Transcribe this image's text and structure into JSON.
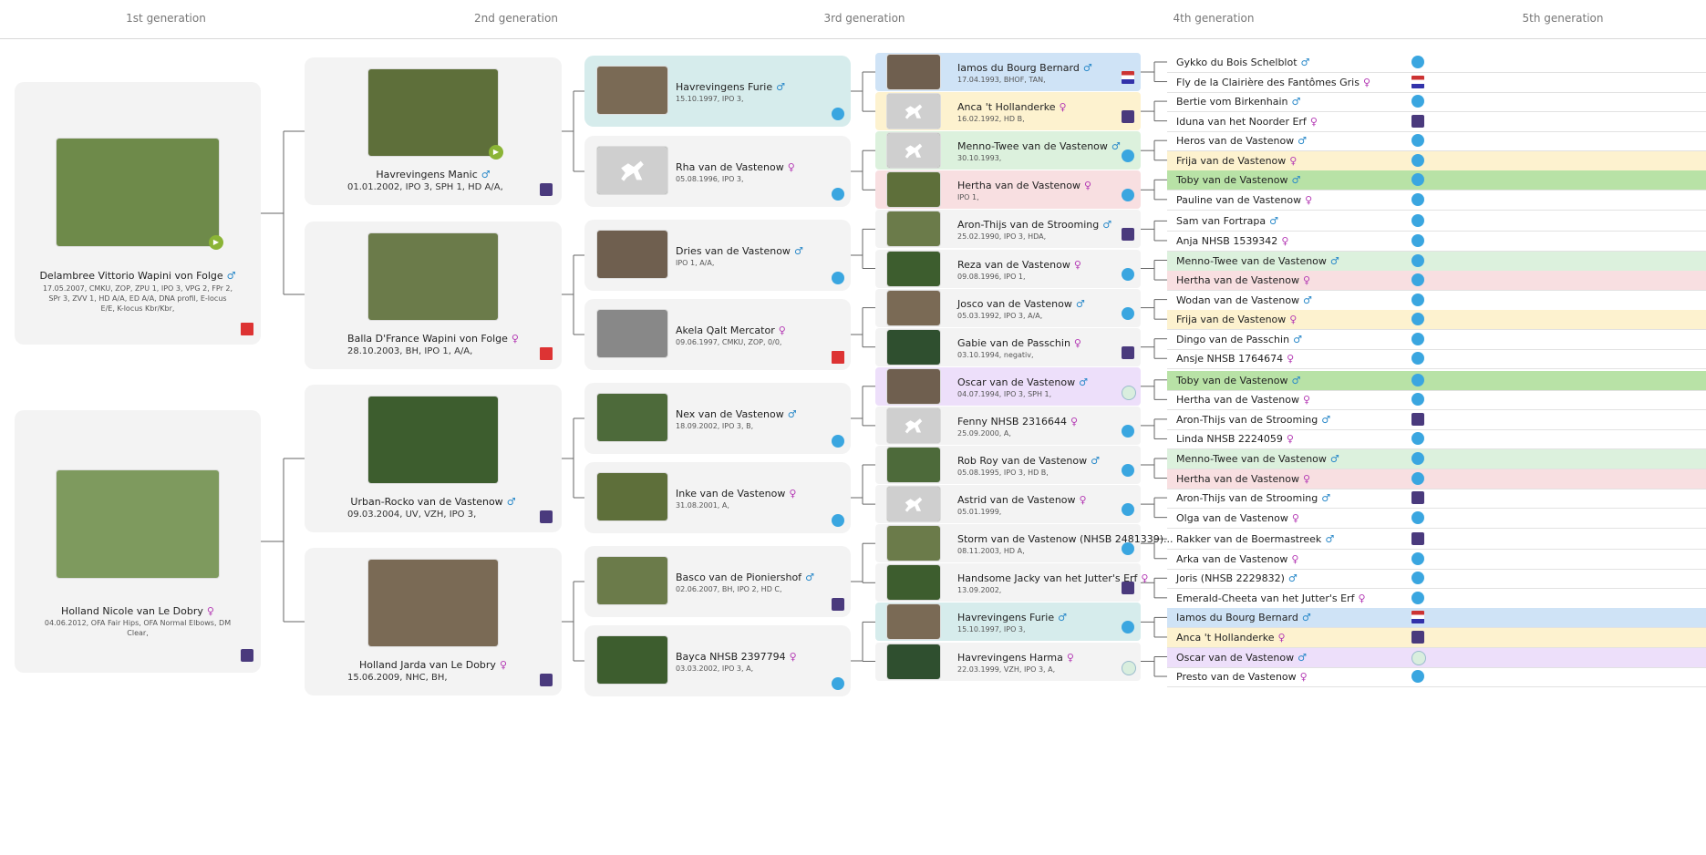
{
  "headers": [
    "1st generation",
    "2nd generation",
    "3rd generation",
    "4th generation",
    "5th generation"
  ],
  "colors": {
    "male": "#2a89c9",
    "female": "#b43ab4",
    "blue": "#cfe3f6",
    "yellow": "#fdf2cf",
    "green": "#dcf1dd",
    "pink": "#f8dfe1",
    "teal": "#d6ecec",
    "purple": "#eddffa",
    "greenStrong": "#b8e2a6"
  },
  "gen1": [
    {
      "name": "Delambree Vittorio Wapini von Folge",
      "sex": "♂",
      "info": "17.05.2007, CMKU, ZOP, ZPU 1, IPO 3, VPG 2, FPr 2, SPr 3, ZVV 1, HD A/A, ED A/A, DNA profil, E-locus E/E, K-locus Kbr/Kbr,",
      "badge": "flag-icon"
    },
    {
      "name": "Holland Nicole van Le Dobry",
      "sex": "♀",
      "info": "04.06.2012, OFA Fair Hips, OFA Normal Elbows, DM Clear,",
      "badge": "club-icon"
    }
  ],
  "gen2": [
    {
      "name": "Havrevingens Manic",
      "sex": "♂",
      "info": "01.01.2002, IPO 3, SPH 1, HD A/A,"
    },
    {
      "name": "Balla D'France Wapini von Folge",
      "sex": "♀",
      "info": "28.10.2003, BH, IPO 1, A/A,"
    },
    {
      "name": "Urban-Rocko van de Vastenow",
      "sex": "♂",
      "info": "09.03.2004, UV, VZH, IPO 3,"
    },
    {
      "name": "Holland Jarda van Le Dobry",
      "sex": "♀",
      "info": "15.06.2009, NHC, BH,"
    }
  ],
  "gen3": [
    {
      "name": "Havrevingens Furie",
      "sex": "♂",
      "info": "15.10.1997, IPO 3,"
    },
    {
      "name": "Rha van de Vastenow",
      "sex": "♀",
      "info": "05.08.1996, IPO 3,"
    },
    {
      "name": "Dries van de Vastenow",
      "sex": "♂",
      "info": "IPO 1, A/A,"
    },
    {
      "name": "Akela Qalt Mercator",
      "sex": "♀",
      "info": "09.06.1997, CMKU, ZOP, 0/0,"
    },
    {
      "name": "Nex van de Vastenow",
      "sex": "♂",
      "info": "18.09.2002, IPO 3, B,"
    },
    {
      "name": "Inke van de Vastenow",
      "sex": "♀",
      "info": "31.08.2001, A,"
    },
    {
      "name": "Basco van de Pioniershof",
      "sex": "♂",
      "info": "02.06.2007, BH, IPO 2, HD C,"
    },
    {
      "name": "Bayca NHSB 2397794",
      "sex": "♀",
      "info": "03.03.2002, IPO 3, A,"
    }
  ],
  "gen4": [
    {
      "name": "Iamos du Bourg Bernard",
      "sex": "♂",
      "info": "17.04.1993, BHOF, TAN,"
    },
    {
      "name": "Anca 't Hollanderke",
      "sex": "♀",
      "info": "16.02.1992, HD B,"
    },
    {
      "name": "Menno-Twee van de Vastenow",
      "sex": "♂",
      "info": "30.10.1993,"
    },
    {
      "name": "Hertha van de Vastenow",
      "sex": "♀",
      "info": "IPO 1,"
    },
    {
      "name": "Aron-Thijs van de Strooming",
      "sex": "♂",
      "info": "25.02.1990, IPO 3, HDA,"
    },
    {
      "name": "Reza van de Vastenow",
      "sex": "♀",
      "info": "09.08.1996, IPO 1,"
    },
    {
      "name": "Josco van de Vastenow",
      "sex": "♂",
      "info": "05.03.1992, IPO 3, A/A,"
    },
    {
      "name": "Gabie van de Passchin",
      "sex": "♀",
      "info": "03.10.1994, negativ,"
    },
    {
      "name": "Oscar van de Vastenow",
      "sex": "♂",
      "info": "04.07.1994, IPO 3, SPH 1,"
    },
    {
      "name": "Fenny NHSB 2316644",
      "sex": "♀",
      "info": "25.09.2000, A,"
    },
    {
      "name": "Rob Roy van de Vastenow",
      "sex": "♂",
      "info": "05.08.1995, IPO 3, HD B,"
    },
    {
      "name": "Astrid van de Vastenow",
      "sex": "♀",
      "info": "05.01.1999,"
    },
    {
      "name": "Storm van de Vastenow (NHSB 2481339)...",
      "sex": "",
      "info": "08.11.2003, HD A,"
    },
    {
      "name": "Handsome Jacky van het Jutter's Erf",
      "sex": "♀",
      "info": "13.09.2002,"
    },
    {
      "name": "Havrevingens Furie",
      "sex": "♂",
      "info": "15.10.1997, IPO 3,"
    },
    {
      "name": "Havrevingens Harma",
      "sex": "♀",
      "info": "22.03.1999, VZH, IPO 3, A,"
    }
  ],
  "gen5": [
    {
      "name": "Gykko du Bois Schelblot",
      "sex": "♂"
    },
    {
      "name": "Fly de la Clairière des Fantômes Gris",
      "sex": "♀"
    },
    {
      "name": "Bertie vom Birkenhain",
      "sex": "♂"
    },
    {
      "name": "Iduna van het Noorder Erf",
      "sex": "♀"
    },
    {
      "name": "Heros van de Vastenow",
      "sex": "♂"
    },
    {
      "name": "Frija van de Vastenow",
      "sex": "♀"
    },
    {
      "name": "Toby van de Vastenow",
      "sex": "♂"
    },
    {
      "name": "Pauline van de Vastenow",
      "sex": "♀"
    },
    {
      "name": "Sam van Fortrapa",
      "sex": "♂"
    },
    {
      "name": "Anja NHSB 1539342",
      "sex": "♀"
    },
    {
      "name": "Menno-Twee van de Vastenow",
      "sex": "♂"
    },
    {
      "name": "Hertha van de Vastenow",
      "sex": "♀"
    },
    {
      "name": "Wodan van de Vastenow",
      "sex": "♂"
    },
    {
      "name": "Frija van de Vastenow",
      "sex": "♀"
    },
    {
      "name": "Dingo van de Passchin",
      "sex": "♂"
    },
    {
      "name": "Ansje NHSB 1764674",
      "sex": "♀"
    },
    {
      "name": "Toby van de Vastenow",
      "sex": "♂"
    },
    {
      "name": "Hertha van de Vastenow",
      "sex": "♀"
    },
    {
      "name": "Aron-Thijs van de Strooming",
      "sex": "♂"
    },
    {
      "name": "Linda NHSB 2224059",
      "sex": "♀"
    },
    {
      "name": "Menno-Twee van de Vastenow",
      "sex": "♂"
    },
    {
      "name": "Hertha van de Vastenow",
      "sex": "♀"
    },
    {
      "name": "Aron-Thijs van de Strooming",
      "sex": "♂"
    },
    {
      "name": "Olga van de Vastenow",
      "sex": "♀"
    },
    {
      "name": "Rakker van de Boermastreek",
      "sex": "♂"
    },
    {
      "name": "Arka van de Vastenow",
      "sex": "♀"
    },
    {
      "name": "Joris (NHSB 2229832)",
      "sex": "♂"
    },
    {
      "name": "Emerald-Cheeta van het Jutter's Erf",
      "sex": "♀"
    },
    {
      "name": "Iamos du Bourg Bernard",
      "sex": "♂"
    },
    {
      "name": "Anca 't Hollanderke",
      "sex": "♀"
    },
    {
      "name": "Oscar van de Vastenow",
      "sex": "♂"
    },
    {
      "name": "Presto van de Vastenow",
      "sex": "♀"
    }
  ]
}
